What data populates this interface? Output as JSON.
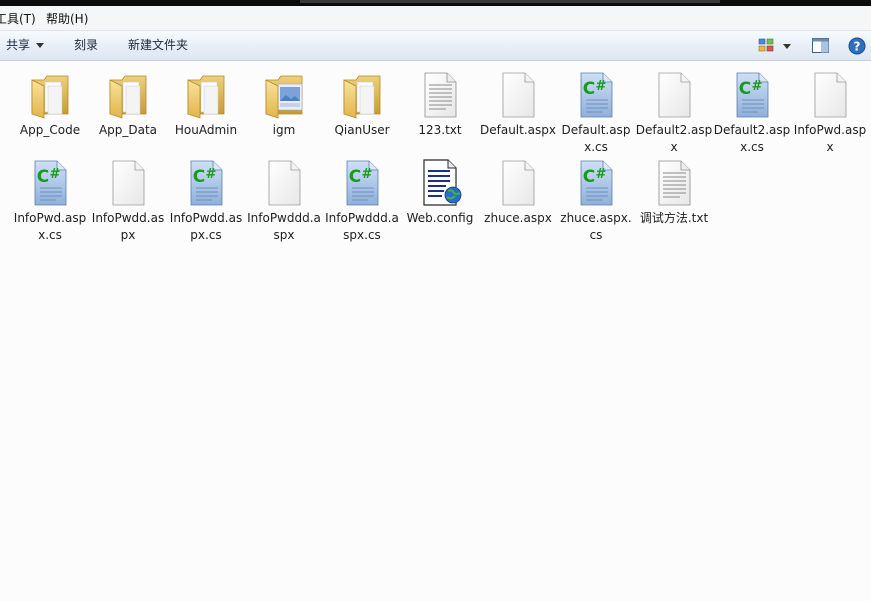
{
  "menubar": {
    "tools": "工具(T)",
    "help": "帮助(H)"
  },
  "toolbar": {
    "share": "共享",
    "burn": "刻录",
    "new_folder": "新建文件夹"
  },
  "files": [
    {
      "name": "App_Code",
      "icon": "folder-icon"
    },
    {
      "name": "App_Data",
      "icon": "folder-icon"
    },
    {
      "name": "HouAdmin",
      "icon": "folder-icon"
    },
    {
      "name": "igm",
      "icon": "folder-image-icon"
    },
    {
      "name": "QianUser",
      "icon": "folder-icon"
    },
    {
      "name": "123.txt",
      "icon": "text-file-icon"
    },
    {
      "name": "Default.aspx",
      "icon": "blank-file-icon"
    },
    {
      "name": "Default.aspx.cs",
      "icon": "csharp-file-icon"
    },
    {
      "name": "Default2.aspx",
      "icon": "blank-file-icon"
    },
    {
      "name": "Default2.aspx.cs",
      "icon": "csharp-file-icon"
    },
    {
      "name": "InfoPwd.aspx",
      "icon": "blank-file-icon"
    },
    {
      "name": "InfoPwd.aspx.cs",
      "icon": "csharp-file-icon"
    },
    {
      "name": "InfoPwdd.aspx",
      "icon": "blank-file-icon"
    },
    {
      "name": "InfoPwdd.aspx.cs",
      "icon": "csharp-file-icon"
    },
    {
      "name": "InfoPwddd.aspx",
      "icon": "blank-file-icon"
    },
    {
      "name": "InfoPwddd.aspx.cs",
      "icon": "csharp-file-icon"
    },
    {
      "name": "Web.config",
      "icon": "config-file-icon"
    },
    {
      "name": "zhuce.aspx",
      "icon": "blank-file-icon"
    },
    {
      "name": "zhuce.aspx.cs",
      "icon": "csharp-file-icon"
    },
    {
      "name": "调试方法.txt",
      "icon": "text-file-icon"
    }
  ]
}
